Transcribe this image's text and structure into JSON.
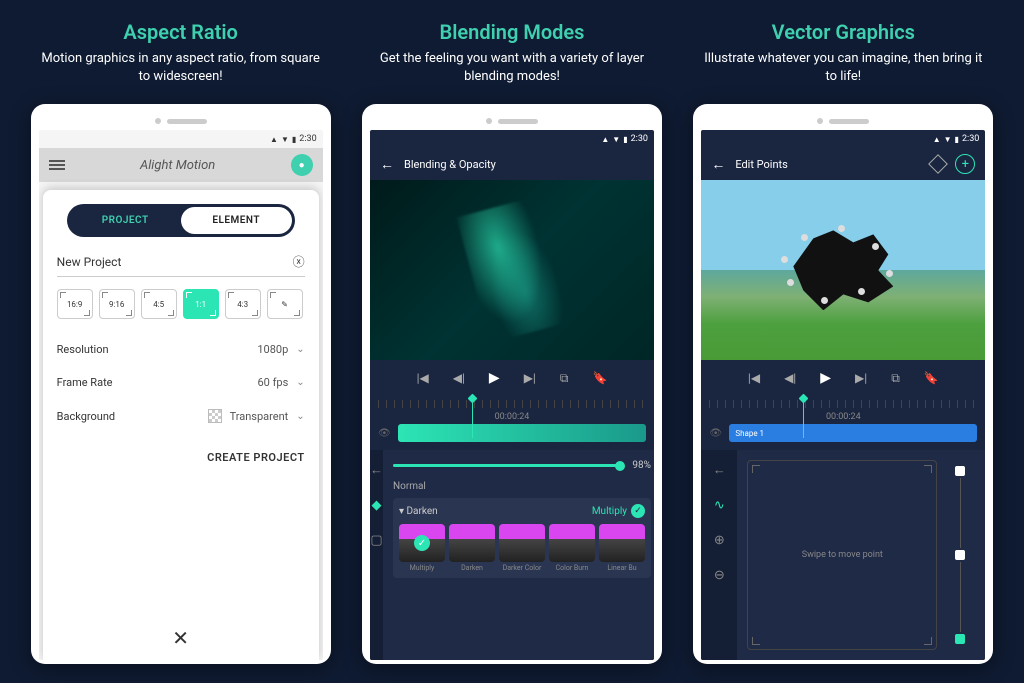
{
  "panels": [
    {
      "title": "Aspect Ratio",
      "subtitle": "Motion graphics in any aspect ratio, from square to widescreen!"
    },
    {
      "title": "Blending Modes",
      "subtitle": "Get the feeling you want with a variety of layer blending modes!"
    },
    {
      "title": "Vector Graphics",
      "subtitle": "Illustrate whatever you can imagine, then bring it to life!"
    }
  ],
  "status_time": "2:30",
  "app_name": "Alight Motion",
  "tabs": {
    "project": "PROJECT",
    "element": "ELEMENT"
  },
  "project": {
    "name_label": "New Project",
    "aspects": [
      "16:9",
      "9:16",
      "4:5",
      "1:1",
      "4:3"
    ],
    "selected_aspect": "1:1",
    "resolution_label": "Resolution",
    "resolution_value": "1080p",
    "framerate_label": "Frame Rate",
    "framerate_value": "60 fps",
    "background_label": "Background",
    "background_value": "Transparent",
    "create_label": "CREATE PROJECT"
  },
  "blending": {
    "header": "Blending & Opacity",
    "timestamp": "00:00:24",
    "opacity": "98%",
    "normal_label": "Normal",
    "category": "Darken",
    "active_mode": "Multiply",
    "modes": [
      "Multiply",
      "Darken",
      "Darker Color",
      "Color Burn",
      "Linear Bu"
    ]
  },
  "vector": {
    "header": "Edit Points",
    "timestamp": "00:00:24",
    "shape_label": "Shape 1",
    "swipe_hint": "Swipe to move point"
  }
}
